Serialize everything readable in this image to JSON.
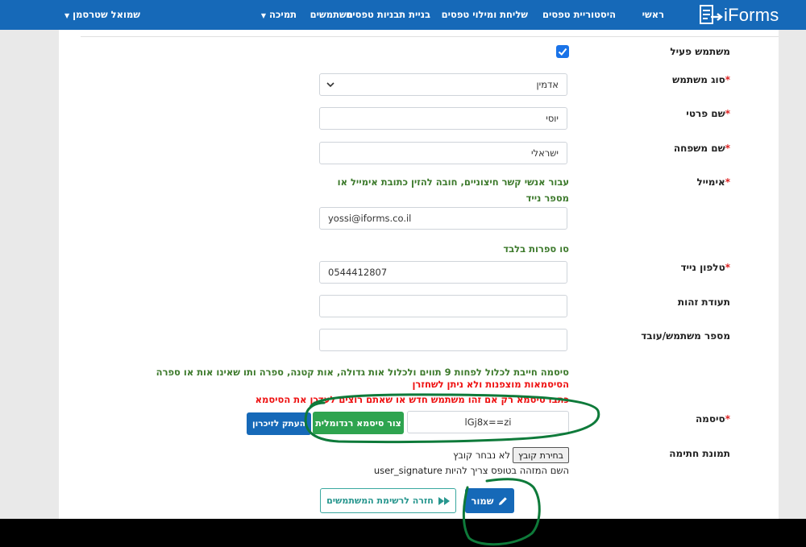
{
  "nav": {
    "brand": "iForms",
    "items": [
      {
        "label": "ראשי"
      },
      {
        "label": "היסטוריית טפסים"
      },
      {
        "label": "שליחת ומילוי טפסים"
      },
      {
        "label": "בניית תבניות טפסים"
      },
      {
        "label": "משתמשים"
      },
      {
        "label": "תמיכה"
      }
    ],
    "user_name": "שמואל שטרסמן"
  },
  "form": {
    "active_label": "משתמש פעיל",
    "active_checked": true,
    "user_type_label": "סוג משתמש",
    "user_type_value": "אדמין",
    "first_name_label": "שם פרטי",
    "first_name_value": "יוסי",
    "last_name_label": "שם משפחה",
    "last_name_value": "ישראלי",
    "email_label": "אימייל",
    "email_note": "עבור אנשי קשר חיצוניים, חובה להזין כתובת אימייל או מספר נייד",
    "email_value": "yossi@iforms.co.il",
    "phone_note": "סו ספרות בלבד",
    "phone_label": "טלפון נייד",
    "phone_value": "0544412807",
    "id_label": "תעודת זהות",
    "id_value": "",
    "employee_label": "מספר משתמש/עובד",
    "employee_value": "",
    "password_rule": "סיסמה חייבת לכלול לפחות 9 תווים ולכלול אות גדולה, אות קטנה, ספרה ותו שאינו אות או ספרה",
    "password_encrypted_note": "הסיסמאות מוצפנות ולא ניתן לשחזרן",
    "password_update_note": "כתבו סיסמא רק אם זהו משתמש חדש או שאתם רוצים לעדכן את הסיסמא",
    "password_label": "סיסמה",
    "password_value": "lGj8x==zi",
    "random_password_button": "צור סיסמא רנדומלית",
    "copy_button": "העתק לזיכרון",
    "signature_label": "תמונת חתימה",
    "choose_file_button": "בחירת קובץ",
    "no_file_text": "לא נבחר קובץ",
    "signature_hint": "השם המזהה בטופס צריך להיות user_signature",
    "back_button": "חזרה לרשימת המשתמשים",
    "save_button": "שמור"
  },
  "colors": {
    "primary": "#1669b8",
    "success": "#2ea44f",
    "note_green": "#3d7a2c",
    "note_red": "#e11111",
    "annotation": "#0e7a3a"
  }
}
